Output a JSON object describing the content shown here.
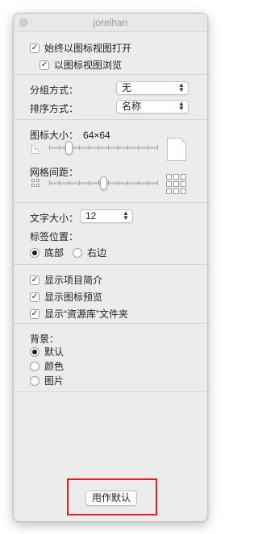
{
  "window": {
    "title": "jorelhan"
  },
  "top_options": {
    "always_open_icon_view": {
      "label": "始终以图标视图打开",
      "checked": true
    },
    "browse_icon_view": {
      "label": "以图标视图浏览",
      "checked": true
    }
  },
  "grouping": {
    "label": "分组方式：",
    "value": "无"
  },
  "sorting": {
    "label": "排序方式：",
    "value": "名称"
  },
  "icon_size": {
    "label": "图标大小：",
    "value": "64×64",
    "level": 0.18
  },
  "grid_spacing": {
    "label": "网格间距：",
    "level": 0.5
  },
  "text_size": {
    "label": "文字大小：",
    "value": "12"
  },
  "label_position": {
    "label": "标签位置：",
    "options": [
      "底部",
      "右边"
    ],
    "selected": "底部"
  },
  "display_options": [
    {
      "label": "显示项目简介",
      "checked": true
    },
    {
      "label": "显示图标预览",
      "checked": true
    },
    {
      "label": "显示“资源库”文件夹",
      "checked": true
    }
  ],
  "background": {
    "label": "背景：",
    "options": [
      "默认",
      "颜色",
      "图片"
    ],
    "selected": "默认"
  },
  "use_as_defaults": {
    "label": "用作默认"
  },
  "colors": {
    "highlight": "#e21e1e",
    "window_bg": "#ececec"
  }
}
